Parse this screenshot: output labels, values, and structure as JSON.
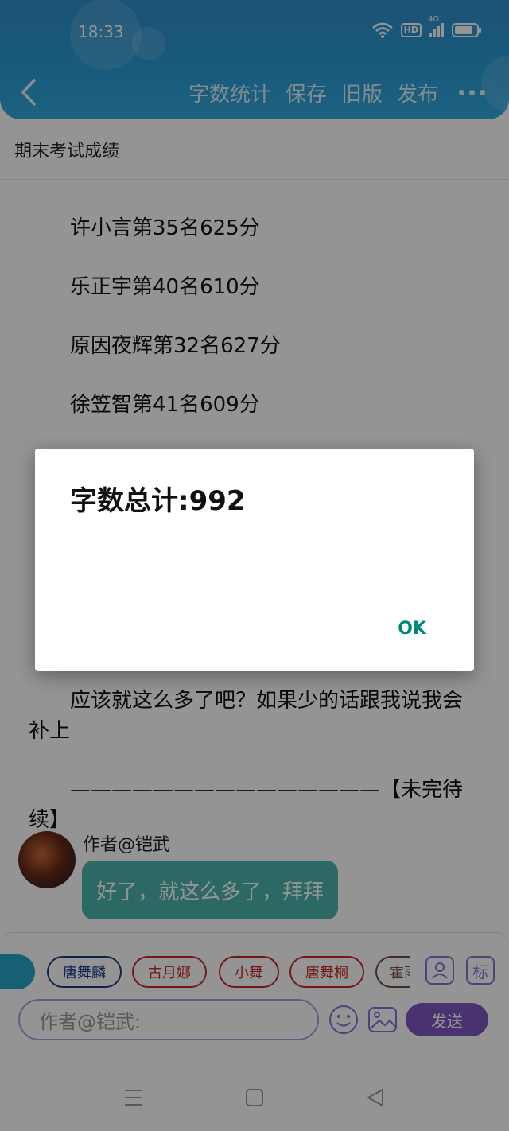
{
  "status_bar": {
    "time": "18:33",
    "hd": "HD",
    "network": "4G"
  },
  "toolbar": {
    "word_count_label": "字数统计",
    "save_label": "保存",
    "old_version_label": "旧版",
    "publish_label": "发布"
  },
  "document": {
    "title": "期末考试成绩",
    "lines": [
      "许小言第35名625分",
      "乐正宇第40名610分",
      "原因夜辉第32名627分",
      "徐笠智第41名609分",
      "应该就这么多了吧？如果少的话跟我说我会补上",
      "———————————————【未完待续】"
    ]
  },
  "comment": {
    "author": "作者@铠武",
    "message": "好了，就这么多了，拜拜"
  },
  "input_panel": {
    "tags": [
      "唐舞麟",
      "古月娜",
      "小舞",
      "唐舞桐",
      "霍雨浩"
    ],
    "tag_colors": [
      "#1e3a8a",
      "#c62828",
      "#c62828",
      "#c62828",
      "#6d4c41"
    ],
    "tag_partial_left": "",
    "contact_icon": "person-icon",
    "mark_label": "标",
    "input_placeholder": "作者@铠武:",
    "send_label": "发送",
    "accent": "#7e57c2"
  },
  "dialog": {
    "message": "字数总计:992",
    "ok_label": "OK",
    "ok_color": "#00897b"
  }
}
